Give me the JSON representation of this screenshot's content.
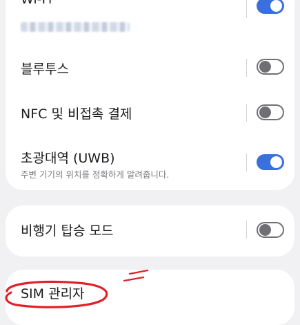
{
  "connections": {
    "wifi": {
      "label": "Wi-Fi",
      "network_name_blurred": true,
      "enabled": true
    },
    "bluetooth": {
      "label": "블루투스",
      "enabled": false
    },
    "nfc": {
      "label": "NFC 및 비접촉 결제",
      "enabled": false
    },
    "uwb": {
      "label": "초광대역 (UWB)",
      "description": "주변 기기의 위치를 정확하게 알려줍니다.",
      "enabled": true
    },
    "airplane": {
      "label": "비행기 탑승 모드",
      "enabled": false
    },
    "sim": {
      "label": "SIM 관리자"
    }
  },
  "colors": {
    "background": "#f1f1f3",
    "card": "#ffffff",
    "toggle_on": "#3a6fde",
    "toggle_off_outline": "#6f6f74",
    "annotation_red": "#e1202a"
  }
}
